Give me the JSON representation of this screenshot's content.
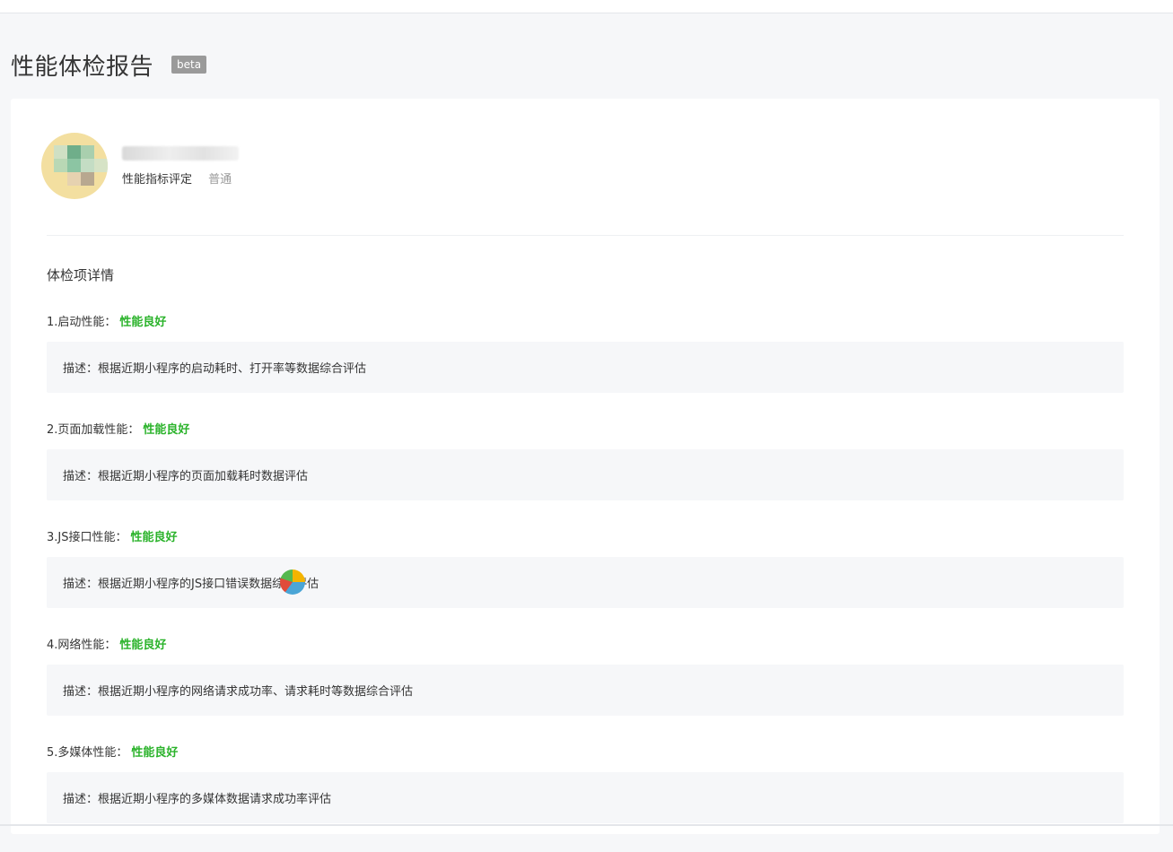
{
  "page": {
    "title": "性能体检报告",
    "badge": "beta"
  },
  "profile": {
    "rating_label": "性能指标评定",
    "rating_value": "普通"
  },
  "section_title": "体检项详情",
  "items": [
    {
      "label": "1.启动性能：",
      "status": "性能良好",
      "desc": "描述：根据近期小程序的启动耗时、打开率等数据综合评估"
    },
    {
      "label": "2.页面加载性能：",
      "status": "性能良好",
      "desc": "描述：根据近期小程序的页面加载耗时数据评估"
    },
    {
      "label": "3.JS接口性能：",
      "status": "性能良好",
      "desc": "描述：根据近期小程序的JS接口错误数据综合评估"
    },
    {
      "label": "4.网络性能：",
      "status": "性能良好",
      "desc": "描述：根据近期小程序的网络请求成功率、请求耗时等数据综合评估"
    },
    {
      "label": "5.多媒体性能：",
      "status": "性能良好",
      "desc": "描述：根据近期小程序的多媒体数据请求成功率评估"
    }
  ],
  "colors": {
    "status_good": "#2bb32b",
    "muted": "#9a9a9a",
    "page_bg": "#f6f7f9"
  }
}
